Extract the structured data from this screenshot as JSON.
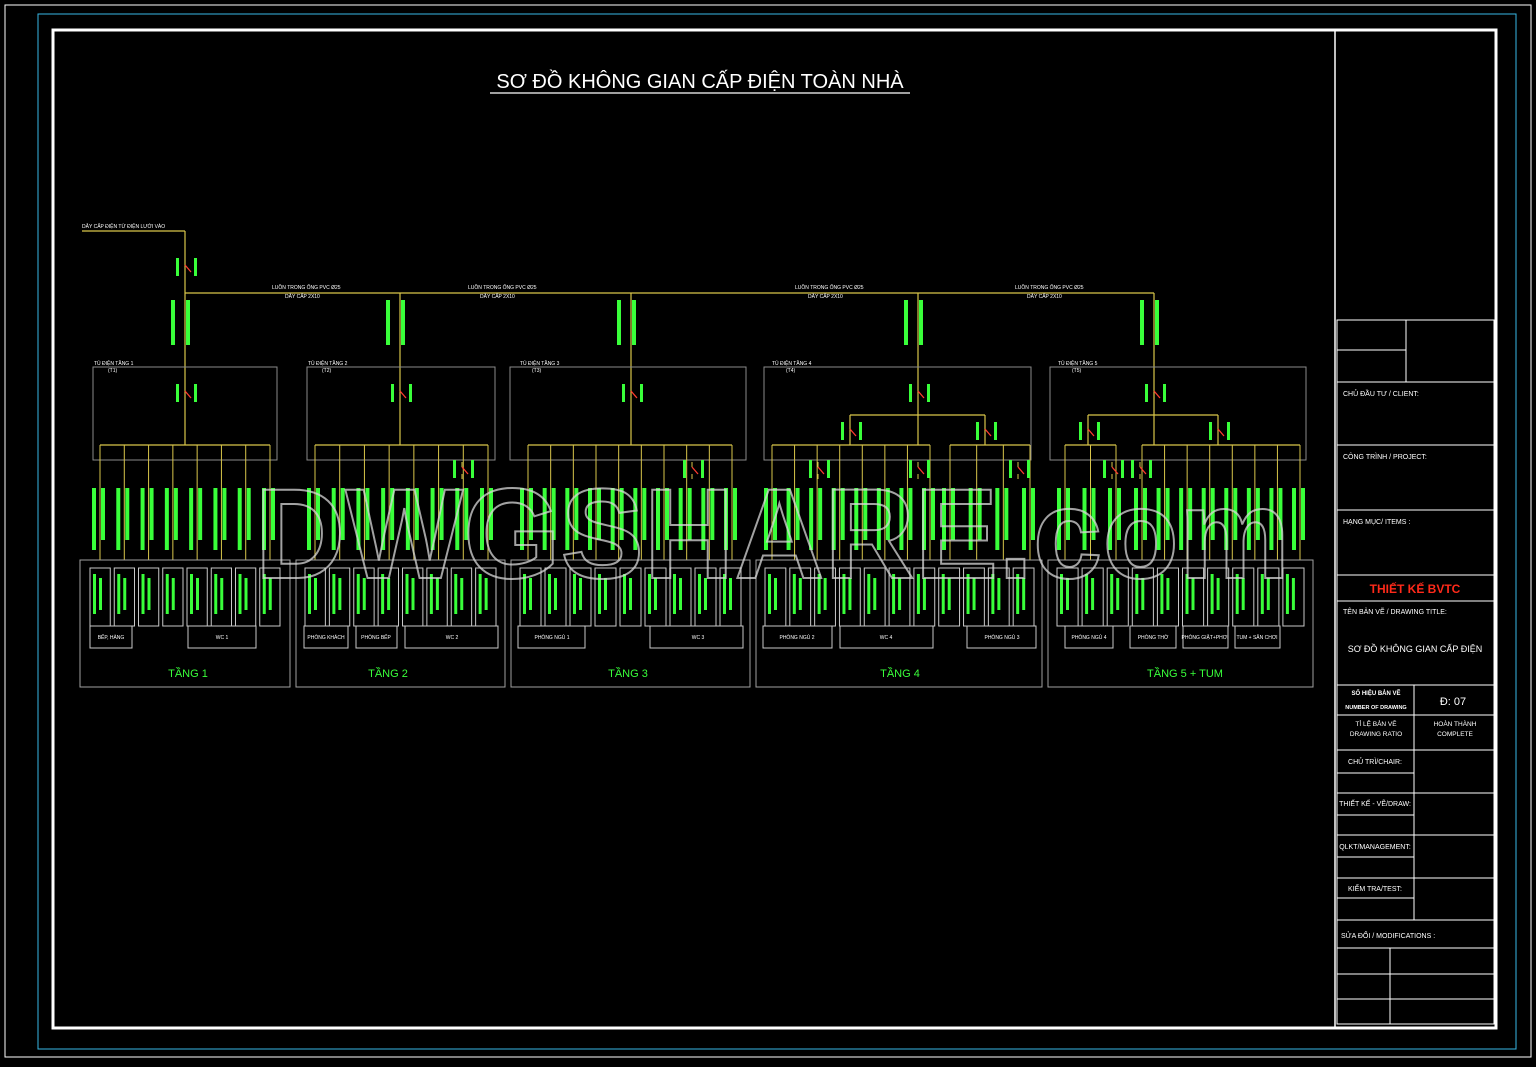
{
  "title": "SƠ ĐỒ KHÔNG GIAN CẤP ĐIỆN TOÀN NHÀ",
  "watermark": "DWGSHARE.com",
  "colors": {
    "background": "#000000",
    "frame": "#ffffff",
    "outer_frame": "#39b8e6",
    "bus_line": "#d9c64a",
    "label_green": "#39ff3a",
    "switch_red": "#ff3b2f",
    "box_outline": "#8a8a8a",
    "title_red": "#ff2a1a"
  },
  "incoming_label": "DÂY CẤP ĐIỆN TỪ ĐIỆN LƯỚI VÀO",
  "bus_labels": [
    {
      "top": "LUỒN TRONG ỐNG PVC Ø25",
      "bottom": "DÂY CẤP 2X10"
    },
    {
      "top": "LUỒN TRONG ỐNG PVC Ø25",
      "bottom": "DÂY CẤP 2X10"
    },
    {
      "top": "LUỒN TRONG ỐNG PVC Ø25",
      "bottom": "DÂY CẤP 2X10"
    },
    {
      "top": "LUỒN TRONG ỐNG PVC Ø25",
      "bottom": "DÂY CẤP 2X10"
    }
  ],
  "panels": [
    {
      "name": "TỦ ĐIỆN TẦNG 1",
      "code": "(T1)"
    },
    {
      "name": "TỦ ĐIỆN TẦNG 2",
      "code": "(T2)"
    },
    {
      "name": "TỦ ĐIỆN TẦNG 3",
      "code": "(T3)"
    },
    {
      "name": "TỦ ĐIỆN TẦNG 4",
      "code": "(T4)"
    },
    {
      "name": "TỦ ĐIỆN TẦNG 5",
      "code": "(T5)"
    }
  ],
  "floors": [
    {
      "label": "TẦNG 1",
      "rooms": [
        "BẾP, HÀNG",
        "WC 1"
      ]
    },
    {
      "label": "TẦNG 2",
      "rooms": [
        "PHÒNG KHÁCH",
        "PHÒNG BẾP",
        "WC 2"
      ]
    },
    {
      "label": "TẦNG 3",
      "rooms": [
        "PHÒNG NGỦ 1",
        "WC 3"
      ]
    },
    {
      "label": "TẦNG 4",
      "rooms": [
        "PHÒNG NGỦ 2",
        "WC 4",
        "PHÒNG NGỦ 3"
      ]
    },
    {
      "label": "TẦNG 5 + TUM",
      "rooms": [
        "PHÒNG NGỦ 4",
        "PHÒNG THỜ",
        "PHÒNG GIẶT+PHƠI",
        "TUM + SÂN CHƠI"
      ]
    }
  ],
  "title_block": {
    "client": "CHỦ ĐẦU TƯ / CLIENT:",
    "project": "CÔNG TRÌNH / PROJECT:",
    "items": "HẠNG MỤC/ ITEMS :",
    "company": "THIẾT KẾ BVTC",
    "drawing_title_label": "TÊN BẢN VẼ / DRAWING TITLE:",
    "drawing_title": "SƠ ĐỒ KHÔNG GIAN CẤP ĐIỆN",
    "number_label_1": "SỐ HIỆU BẢN VẼ",
    "number_label_2": "NUMBER OF DRAWING",
    "number_value": "Đ: 07",
    "ratio_label_1": "TỈ LỆ BẢN VẼ",
    "ratio_label_2": "DRAWING RATIO",
    "status_1": "HOÀN THÀNH",
    "status_2": "COMPLETE",
    "chair": "CHỦ TRÌ/CHAIR:",
    "draw": "THIẾT KẾ - VẼ/DRAW:",
    "management": "QLKT/MANAGEMENT:",
    "test": "KIỂM TRA/TEST:",
    "modifications": "SỬA ĐỔI / MODIFICATIONS :"
  }
}
